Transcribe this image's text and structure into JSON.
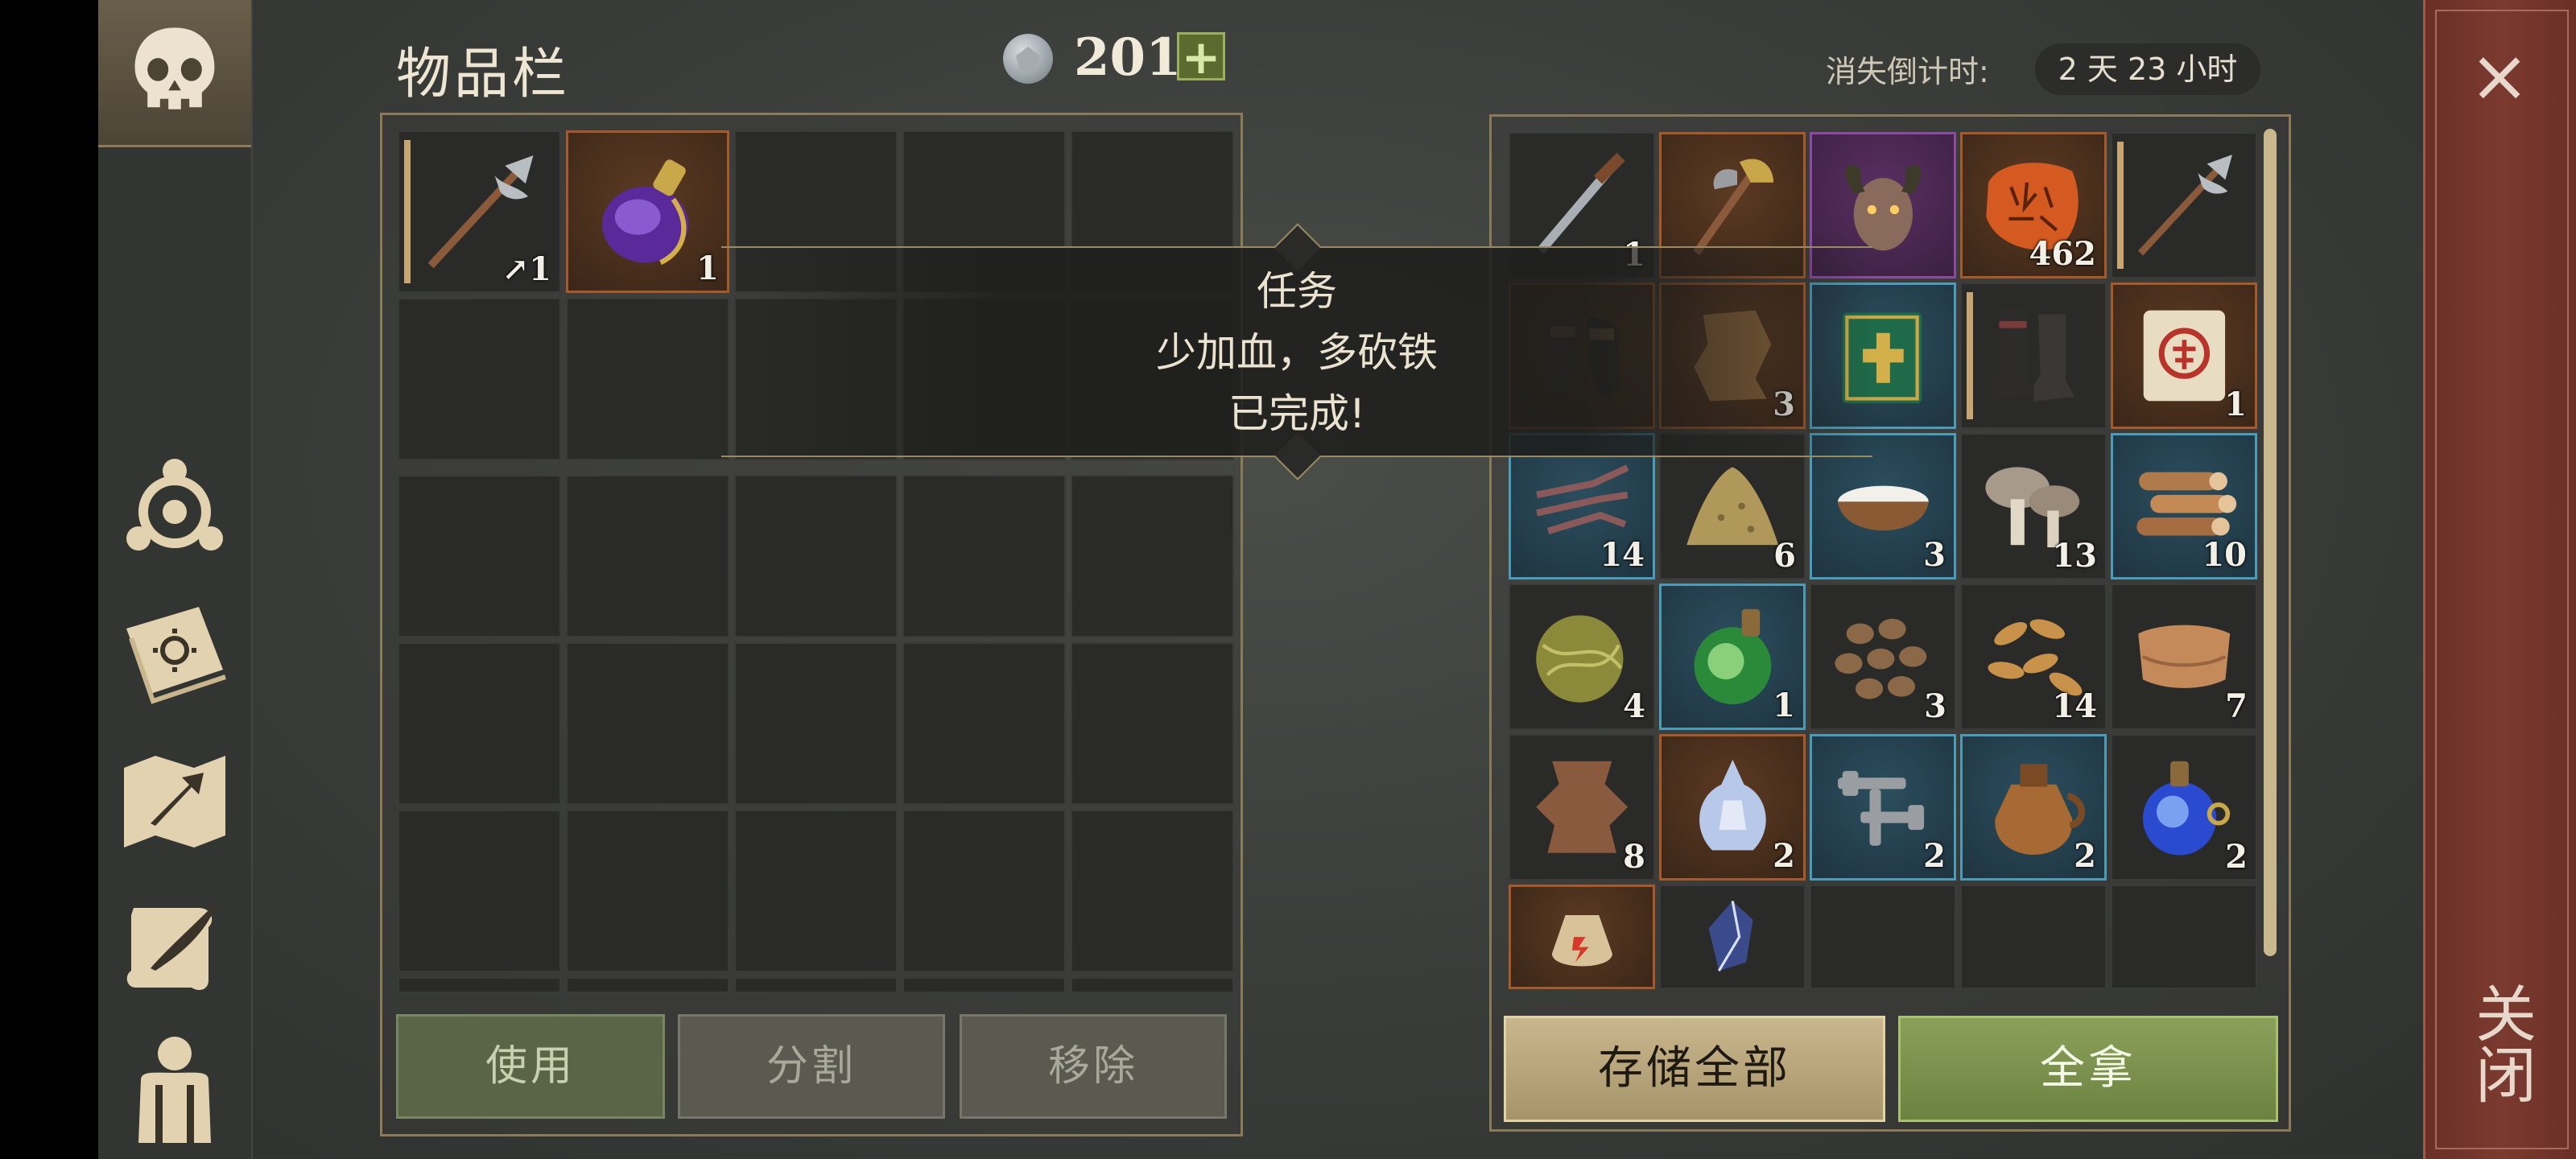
{
  "header": {
    "title": "物品栏",
    "currency_amount": "201",
    "add_currency_label": "+",
    "timer_label": "消失倒计时:",
    "timer_value": "2 天 23 小时"
  },
  "close": {
    "x_label": "×",
    "vertical_label": "关闭"
  },
  "inventory": {
    "slots": [
      {
        "icon": "halberd-icon",
        "count": "↗1",
        "style": "tan"
      },
      {
        "icon": "purple-potion-icon",
        "count": "1",
        "style": "orange"
      }
    ],
    "buttons": {
      "use": "使用",
      "split": "分割",
      "remove": "移除"
    }
  },
  "storage": {
    "slots": [
      {
        "icon": "dagger-icon",
        "count": "1",
        "style": ""
      },
      {
        "icon": "axe-icon",
        "count": "",
        "style": "orange"
      },
      {
        "icon": "demon-head-icon",
        "count": "",
        "style": "purple"
      },
      {
        "icon": "rune-stone-icon",
        "count": "462",
        "style": "orange"
      },
      {
        "icon": "halberd-icon",
        "count": "",
        "style": "tan"
      },
      {
        "icon": "gauntlets-icon",
        "count": "",
        "style": "orange"
      },
      {
        "icon": "leather-scrap-icon",
        "count": "3",
        "style": "orange"
      },
      {
        "icon": "green-book-icon",
        "count": "",
        "style": "blue"
      },
      {
        "icon": "boots-icon",
        "count": "",
        "style": "tan"
      },
      {
        "icon": "scroll-icon",
        "count": "1",
        "style": "orange"
      },
      {
        "icon": "claw-icon",
        "count": "14",
        "style": "blue"
      },
      {
        "icon": "sand-pile-icon",
        "count": "6",
        "style": ""
      },
      {
        "icon": "bowl-icon",
        "count": "3",
        "style": "blue"
      },
      {
        "icon": "mushroom-icon",
        "count": "13",
        "style": ""
      },
      {
        "icon": "firewood-icon",
        "count": "10",
        "style": "blue"
      },
      {
        "icon": "fiber-ball-icon",
        "count": "4",
        "style": ""
      },
      {
        "icon": "green-potion-icon",
        "count": "1",
        "style": "blue"
      },
      {
        "icon": "beans-icon",
        "count": "3",
        "style": ""
      },
      {
        "icon": "seeds-icon",
        "count": "14",
        "style": ""
      },
      {
        "icon": "cloth-icon",
        "count": "7",
        "style": ""
      },
      {
        "icon": "hide-icon",
        "count": "8",
        "style": ""
      },
      {
        "icon": "crystal-potion-icon",
        "count": "2",
        "style": "orange"
      },
      {
        "icon": "nails-icon",
        "count": "2",
        "style": "blue"
      },
      {
        "icon": "jug-icon",
        "count": "2",
        "style": "blue"
      },
      {
        "icon": "blue-potion-icon",
        "count": "2",
        "style": ""
      },
      {
        "icon": "pouch-icon",
        "count": "",
        "style": "orange"
      },
      {
        "icon": "crystal-icon",
        "count": "",
        "style": ""
      },
      {
        "icon": "empty",
        "count": "",
        "style": ""
      },
      {
        "icon": "empty",
        "count": "",
        "style": ""
      },
      {
        "icon": "empty",
        "count": "",
        "style": ""
      }
    ],
    "buttons": {
      "store_all": "存储全部",
      "take_all": "全拿"
    }
  },
  "tooltip": {
    "line1": "任务",
    "line2": "少加血，多砍铁",
    "line3": "已完成!"
  },
  "sidebar": {
    "items": [
      {
        "icon": "skull-icon"
      },
      {
        "icon": "triangle-emblem-icon"
      },
      {
        "icon": "sun-book-icon"
      },
      {
        "icon": "map-arrow-icon"
      },
      {
        "icon": "quill-scroll-icon"
      },
      {
        "icon": "character-icon"
      }
    ]
  },
  "colors": {
    "accent_green": "#6c8240",
    "accent_tan": "#c9b68e",
    "close_red": "#7b3a30",
    "rarity_orange": "#a65a2a",
    "rarity_blue": "#4a9cb8",
    "rarity_purple": "#8c4aa0"
  }
}
